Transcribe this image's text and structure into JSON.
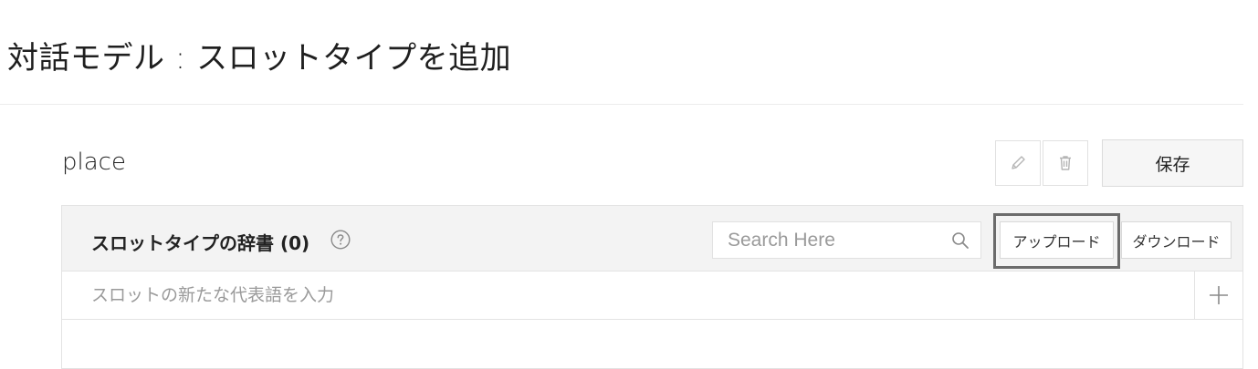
{
  "page": {
    "title": "対話モデル : スロットタイプを追加"
  },
  "slot_type": {
    "name": "place"
  },
  "toolbar": {
    "edit_icon": "pencil-icon",
    "delete_icon": "trash-icon",
    "save_label": "保存"
  },
  "dictionary": {
    "title": "スロットタイプの辞書 (0)",
    "help_icon": "question-circle-icon",
    "search": {
      "placeholder": "Search Here",
      "icon": "search-icon"
    },
    "upload_label": "アップロード",
    "download_label": "ダウンロード",
    "new_value_placeholder": "スロットの新たな代表語を入力",
    "add_icon": "plus-icon"
  },
  "colors": {
    "highlight_border": "#6b6b6b",
    "header_bg": "#f3f3f3",
    "icon_gray": "#b5b5b5"
  }
}
